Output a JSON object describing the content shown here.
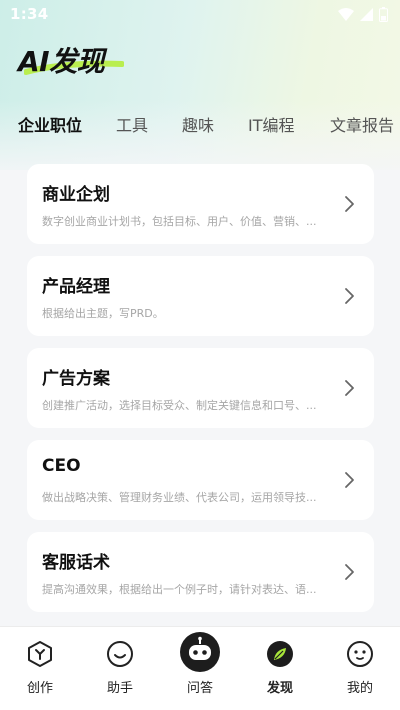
{
  "status": {
    "time": "1:34"
  },
  "header": {
    "title": "AI发现"
  },
  "tabs": [
    {
      "label": "企业职位",
      "active": true
    },
    {
      "label": "工具",
      "active": false
    },
    {
      "label": "趣味",
      "active": false
    },
    {
      "label": "IT编程",
      "active": false
    },
    {
      "label": "文章报告",
      "active": false
    }
  ],
  "cards": [
    {
      "title": "商业企划",
      "desc": "数字创业商业计划书，包括目标、用户、价值、营销、..."
    },
    {
      "title": "产品经理",
      "desc": "根据给出主题，写PRD。"
    },
    {
      "title": "广告方案",
      "desc": "创建推广活动，选择目标受众、制定关键信息和口号、..."
    },
    {
      "title": "CEO",
      "desc": "做出战略决策、管理财务业绩、代表公司，运用领导技..."
    },
    {
      "title": "客服话术",
      "desc": "提高沟通效果，根据给出一个例子时，请针对表达、语..."
    }
  ],
  "tabbar": [
    {
      "label": "创作",
      "icon": "create-icon"
    },
    {
      "label": "助手",
      "icon": "assistant-icon"
    },
    {
      "label": "问答",
      "icon": "robot-icon"
    },
    {
      "label": "发现",
      "icon": "leaf-icon",
      "active": true
    },
    {
      "label": "我的",
      "icon": "profile-icon"
    }
  ],
  "colors": {
    "accent": "#a8e63a",
    "text": "#111111",
    "muted": "#a6a6a6",
    "background": "#f5f6f8"
  }
}
